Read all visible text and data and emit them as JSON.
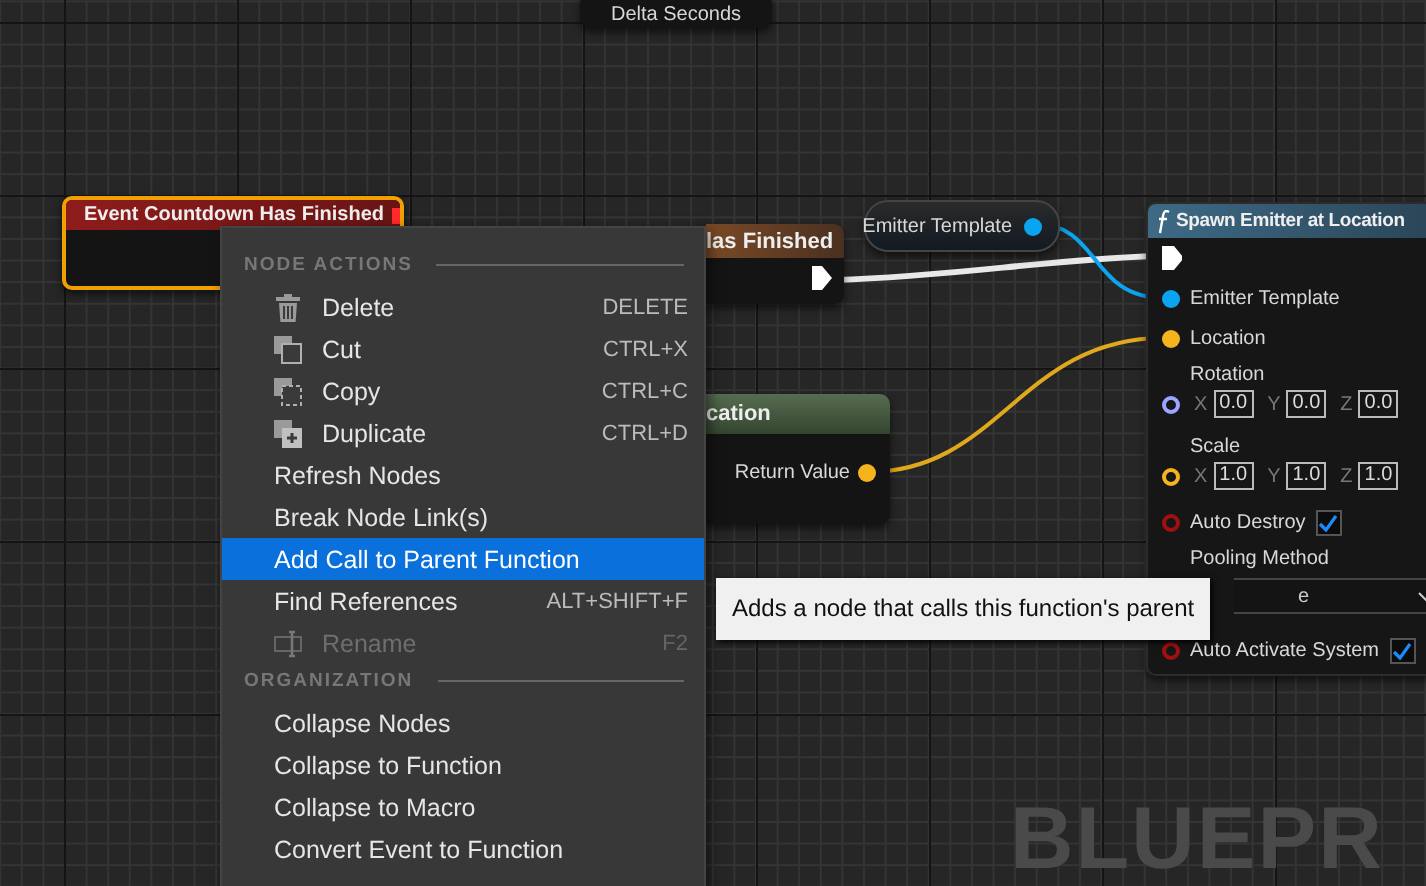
{
  "graph_label": "BLUEPR",
  "delta_node": {
    "pin_label": "Delta Seconds"
  },
  "event_node": {
    "title": "Event Countdown Has Finished",
    "selected": true
  },
  "partial_node": {
    "title": "las Finished"
  },
  "variable_node": {
    "label": "Emitter Template"
  },
  "location_node": {
    "title": "cation",
    "output": "Return Value"
  },
  "spawn_node": {
    "title": "Spawn Emitter at Location",
    "pins": [
      {
        "kind": "exec",
        "connected": true
      },
      {
        "kind": "pin",
        "label": "Emitter Template",
        "connected": true,
        "color": "#0aa4f0"
      },
      {
        "kind": "pin",
        "label": "Location",
        "connected": true,
        "color": "#f5b41e"
      },
      {
        "kind": "vector",
        "label": "Rotation",
        "connected": false,
        "color": "#9aa6ff",
        "fields": [
          {
            "axis": "X",
            "value": "0.0"
          },
          {
            "axis": "Y",
            "value": "0.0"
          },
          {
            "axis": "Z",
            "value": "0.0"
          }
        ]
      },
      {
        "kind": "vector",
        "label": "Scale",
        "connected": false,
        "color": "#f5b41e",
        "fields": [
          {
            "axis": "X",
            "value": "1.0"
          },
          {
            "axis": "Y",
            "value": "1.0"
          },
          {
            "axis": "Z",
            "value": "1.0"
          }
        ]
      },
      {
        "kind": "bool",
        "label": "Auto Destroy",
        "connected": false,
        "color": "#a01010",
        "checked": true
      },
      {
        "kind": "enum",
        "label": "Pooling Method",
        "value": "e"
      },
      {
        "kind": "bool",
        "label": "Auto Activate System",
        "connected": false,
        "color": "#a01010",
        "checked": true
      }
    ]
  },
  "context_menu": {
    "sections": [
      {
        "title": "NODE ACTIONS",
        "items": [
          {
            "label": "Delete",
            "shortcut": "DELETE",
            "selected": false,
            "disabled": false
          },
          {
            "label": "Cut",
            "shortcut": "CTRL+X",
            "selected": false,
            "disabled": false
          },
          {
            "label": "Copy",
            "shortcut": "CTRL+C",
            "selected": false,
            "disabled": false
          },
          {
            "label": "Duplicate",
            "shortcut": "CTRL+D",
            "selected": false,
            "disabled": false
          },
          {
            "label": "Refresh Nodes",
            "selected": false,
            "disabled": false
          },
          {
            "label": "Break Node Link(s)",
            "selected": false,
            "disabled": false
          },
          {
            "label": "Add Call to Parent Function",
            "selected": true,
            "disabled": false
          },
          {
            "label": "Find References",
            "shortcut": "ALT+SHIFT+F",
            "selected": false,
            "disabled": false
          },
          {
            "label": "Rename",
            "shortcut": "F2",
            "selected": false,
            "disabled": true
          }
        ]
      },
      {
        "title": "ORGANIZATION",
        "items": [
          {
            "label": "Collapse Nodes",
            "selected": false,
            "disabled": false
          },
          {
            "label": "Collapse to Function",
            "selected": false,
            "disabled": false
          },
          {
            "label": "Collapse to Macro",
            "selected": false,
            "disabled": false
          },
          {
            "label": "Convert Event to Function",
            "selected": false,
            "disabled": false
          }
        ]
      }
    ]
  },
  "tooltip": {
    "text": "Adds a node that calls this function's parent"
  }
}
